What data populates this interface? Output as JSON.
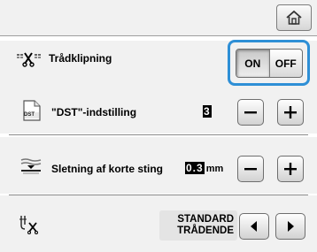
{
  "header": {
    "home_icon": "home-icon"
  },
  "thread_cutting": {
    "label": "Trådklipning",
    "icon": "thread-cutting-icon",
    "on_label": "ON",
    "off_label": "OFF",
    "selected": "ON",
    "highlight_color": "#2e8fd6"
  },
  "dst_setting": {
    "label": "\"DST\"-indstilling",
    "icon": "dst-file-icon",
    "icon_text": "DST",
    "value": "3",
    "minus_icon": "minus-icon",
    "plus_icon": "plus-icon"
  },
  "short_stitch": {
    "label": "Sletning af korte sting",
    "icon": "short-stitch-icon",
    "value": "0.3",
    "unit": "mm",
    "minus_icon": "minus-icon",
    "plus_icon": "plus-icon"
  },
  "thread_ending": {
    "icon": "thread-ending-icon",
    "value_line1": "STANDARD",
    "value_line2": "TRÅDENDE",
    "prev_icon": "left-arrow-icon",
    "next_icon": "right-arrow-icon"
  }
}
